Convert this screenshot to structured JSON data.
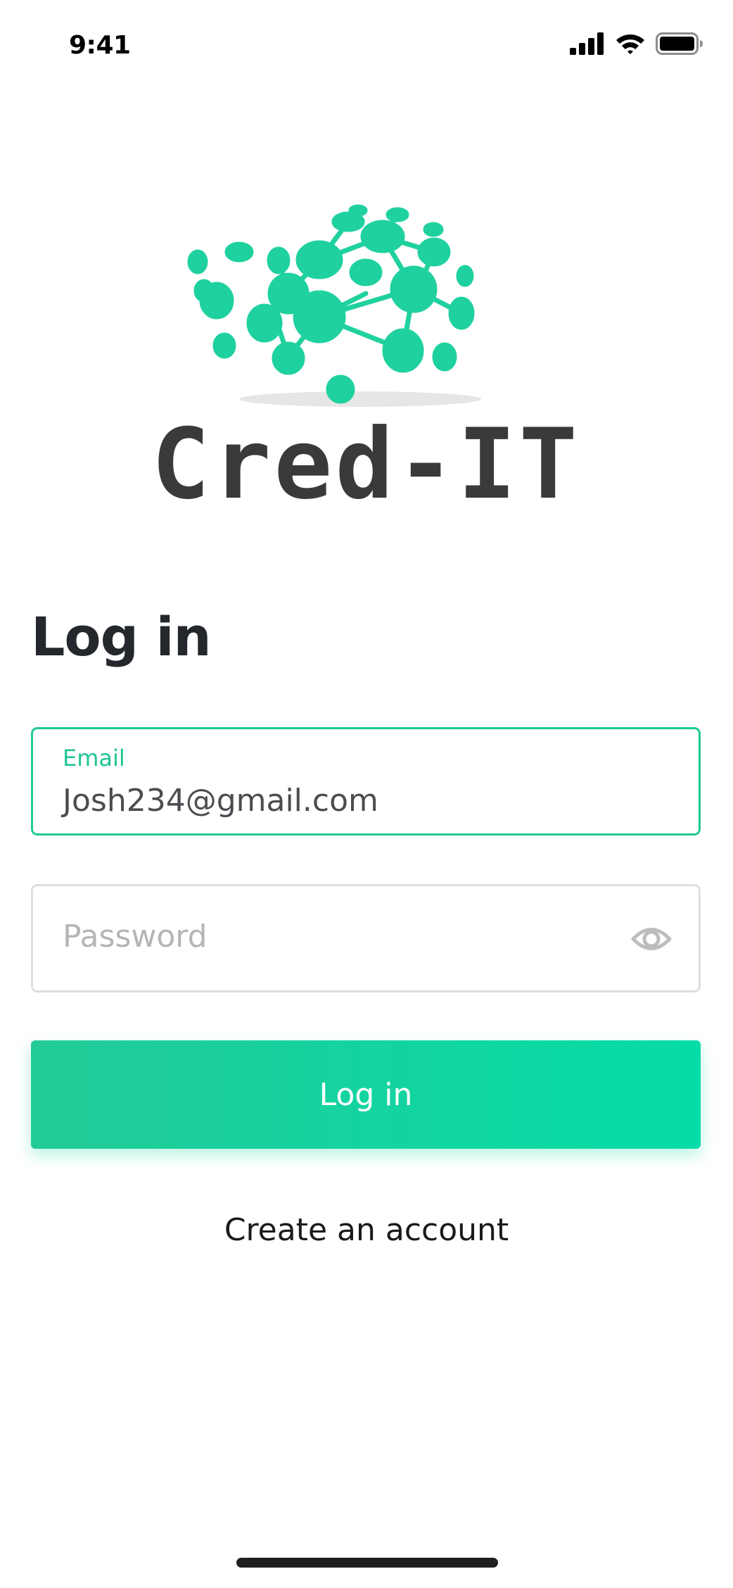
{
  "status_bar": {
    "time": "9:41",
    "icons": [
      "cellular-signal-icon",
      "wifi-icon",
      "battery-icon"
    ]
  },
  "logo": {
    "wordmark": "Cred-IT",
    "icon": "molecule-network-icon",
    "colors": {
      "accent": "#1fd19e",
      "wordmark": "#3a3a3c"
    }
  },
  "login": {
    "title": "Log in",
    "email": {
      "label": "Email",
      "value": "Josh234@gmail.com"
    },
    "password": {
      "placeholder": "Password",
      "toggle_icon": "eye-icon"
    },
    "submit_label": "Log in",
    "create_account_label": "Create an account"
  },
  "colors": {
    "accent": "#20c997",
    "button_gradient_start": "#23cb98",
    "button_gradient_end": "#06dca7",
    "text_dark": "#24272b",
    "placeholder": "#b5b5b5",
    "border_inactive": "#dedede"
  }
}
